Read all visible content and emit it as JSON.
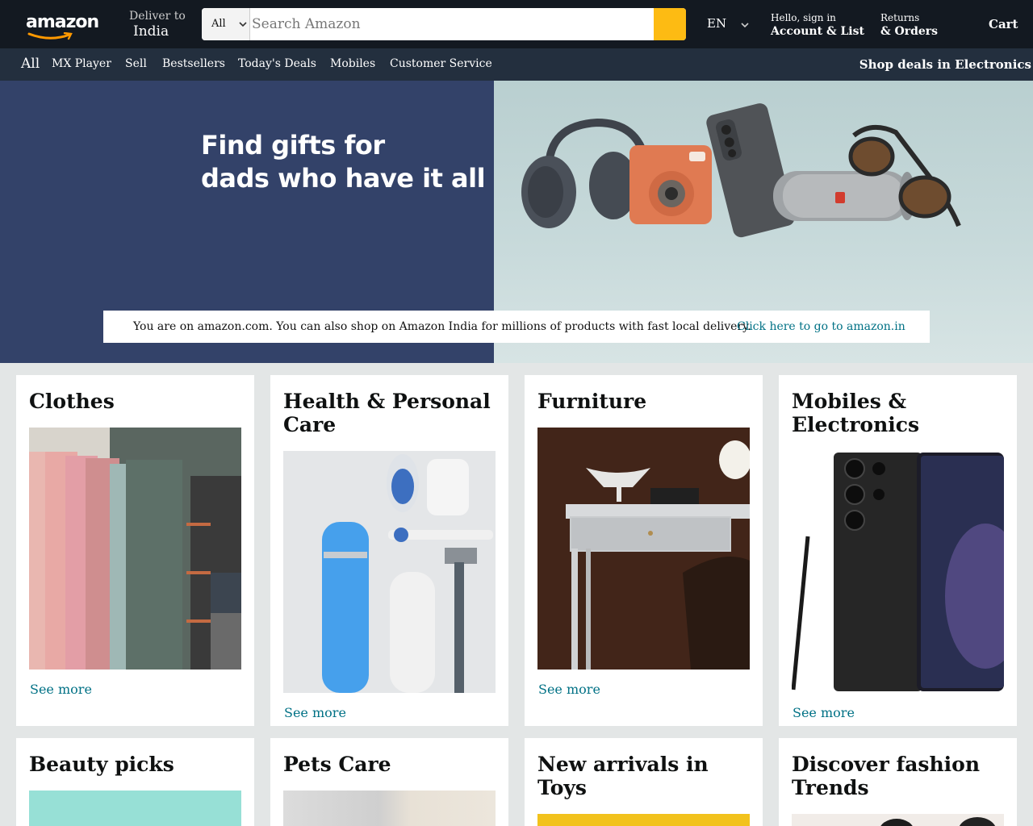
{
  "header": {
    "logo_text": "amazon",
    "deliver_label": "Deliver to",
    "deliver_location": "India",
    "search_category": "All",
    "search_placeholder": "Search Amazon",
    "language": "EN",
    "account_greeting": "Hello, sign in",
    "account_label": "Account & List",
    "returns_label": "Returns",
    "orders_label": "& Orders",
    "cart_label": "Cart"
  },
  "subnav": {
    "all_label": "All",
    "items": [
      "MX Player",
      "Sell",
      "Bestsellers",
      "Today's Deals",
      "Mobiles",
      "Customer Service"
    ],
    "promo": "Shop deals in Electronics"
  },
  "hero": {
    "headline_line1": "Find gifts for",
    "headline_line2": "dads who have it all",
    "products": [
      "headphones-image",
      "instant-camera-image",
      "smartphone-image",
      "speaker-image",
      "sunglasses-image"
    ]
  },
  "notice": {
    "message": "You are on amazon.com. You can also shop on Amazon India for millions of products with fast local delivery.",
    "link_text": "Click here to go to amazon.in"
  },
  "cards": [
    {
      "title": "Clothes",
      "link": "See more"
    },
    {
      "title": "Health & Personal Care",
      "link": "See more"
    },
    {
      "title": "Furniture",
      "link": "See more"
    },
    {
      "title": "Mobiles & Electronics",
      "link": "See more"
    },
    {
      "title": "Beauty picks"
    },
    {
      "title": "Pets Care"
    },
    {
      "title": "New arrivals in Toys"
    },
    {
      "title": "Discover fashion Trends"
    }
  ],
  "colors": {
    "nav_dark": "#131921",
    "nav_sub": "#232f3e",
    "search_button": "#fdbb13",
    "link": "#007185",
    "hero_left": "#334269",
    "page_bg": "#e3e6e6"
  }
}
